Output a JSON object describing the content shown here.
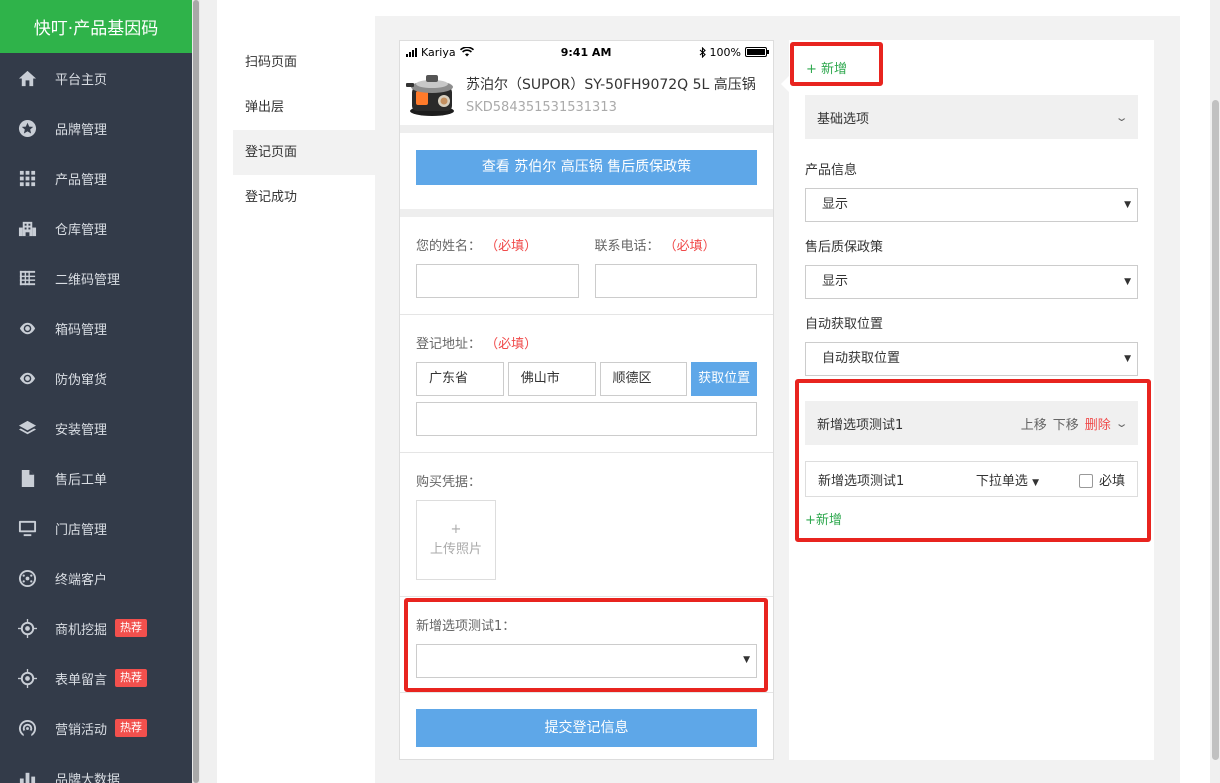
{
  "sidebar": {
    "brand": "快叮·产品基因码",
    "items": [
      {
        "label": "平台主页",
        "icon": "home-icon"
      },
      {
        "label": "品牌管理",
        "icon": "star-icon"
      },
      {
        "label": "产品管理",
        "icon": "grid-icon"
      },
      {
        "label": "仓库管理",
        "icon": "building-icon"
      },
      {
        "label": "二维码管理",
        "icon": "qrcode-icon"
      },
      {
        "label": "箱码管理",
        "icon": "eye-icon"
      },
      {
        "label": "防伪窜货",
        "icon": "eye-icon"
      },
      {
        "label": "安装管理",
        "icon": "layers-icon"
      },
      {
        "label": "售后工单",
        "icon": "document-icon"
      },
      {
        "label": "门店管理",
        "icon": "monitor-icon"
      },
      {
        "label": "终端客户",
        "icon": "globe-icon"
      },
      {
        "label": "商机挖掘",
        "icon": "target-icon",
        "badge": "热荐"
      },
      {
        "label": "表单留言",
        "icon": "target-icon",
        "badge": "热荐"
      },
      {
        "label": "营销活动",
        "icon": "broadcast-icon",
        "badge": "热荐"
      },
      {
        "label": "品牌大数据",
        "icon": "chart-icon"
      }
    ]
  },
  "tabs": [
    "扫码页面",
    "弹出层",
    "登记页面",
    "登记成功"
  ],
  "active_tab": "登记页面",
  "phone": {
    "status": {
      "carrier": "Kariya",
      "time": "9:41 AM",
      "battery": "100%"
    },
    "product": {
      "name": "苏泊尔（SUPOR）SY-50FH9072Q 5L 高压锅",
      "sku": "SKD584351531531313"
    },
    "policy_button": "查看 苏伯尔 高压锅 售后质保政策",
    "form": {
      "name_label": "您的姓名：",
      "phone_label": "联系电话：",
      "required": "（必填）",
      "address_label": "登记地址：",
      "province": "广东省",
      "city": "佛山市",
      "district": "顺德区",
      "locate_button": "获取位置",
      "voucher_label": "购买凭据：",
      "upload_plus": "+",
      "upload_text": "上传照片",
      "custom_label": "新增选项测试1：",
      "submit": "提交登记信息"
    }
  },
  "config": {
    "add_top": "+ 新增",
    "basic_section": "基础选项",
    "product_info_label": "产品信息",
    "product_info_value": "显示",
    "policy_label": "售后质保政策",
    "policy_value": "显示",
    "location_label": "自动获取位置",
    "location_value": "自动获取位置",
    "custom_section": "新增选项测试1",
    "move_up": "上移",
    "move_down": "下移",
    "delete": "删除",
    "option_name": "新增选项测试1",
    "option_type": "下拉单选",
    "required_label": "必填",
    "add_bottom": "+新增"
  },
  "colors": {
    "brand_green": "#2fb34a",
    "sidebar_bg": "#333b49",
    "accent_blue": "#5ea7e8",
    "required_red": "#f04a4a",
    "highlight_red": "#e8241f"
  }
}
